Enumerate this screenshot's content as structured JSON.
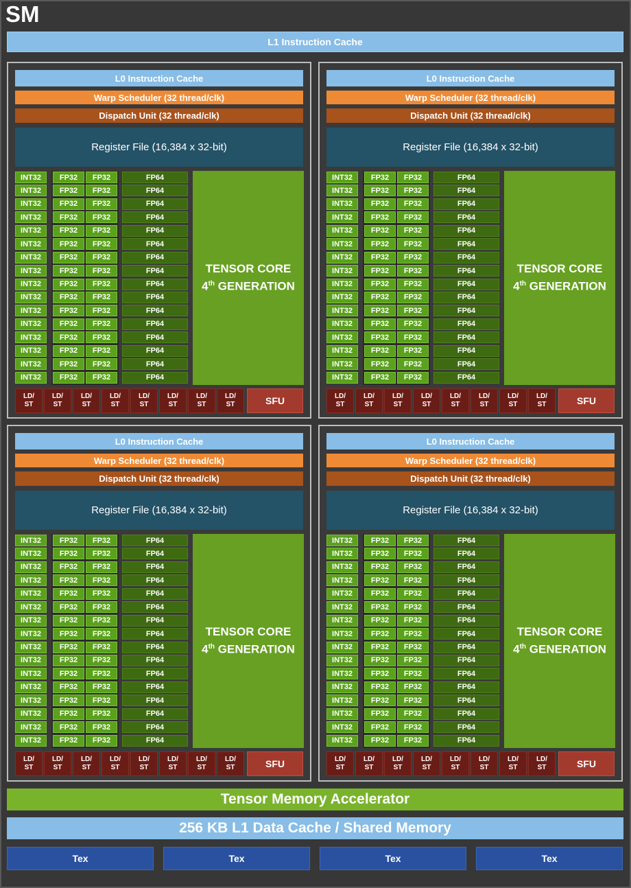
{
  "sm": {
    "title": "SM",
    "l1_instruction_cache": "L1 Instruction Cache",
    "tensor_memory_accelerator": "Tensor Memory Accelerator",
    "l1_data_cache": "256 KB L1 Data Cache / Shared Memory",
    "tex_units": [
      "Tex",
      "Tex",
      "Tex",
      "Tex"
    ]
  },
  "quadrant": {
    "l0_instruction_cache": "L0 Instruction Cache",
    "warp_scheduler": "Warp Scheduler (32 thread/clk)",
    "dispatch_unit": "Dispatch Unit (32 thread/clk)",
    "register_file": "Register File (16,384 x 32-bit)",
    "int32_label": "INT32",
    "fp32_label": "FP32",
    "fp64_label": "FP64",
    "rows_per_column": 16,
    "tensor_core_line1": "TENSOR CORE",
    "tensor_core_line2_num": "4",
    "tensor_core_line2_sup": "th",
    "tensor_core_line2_rest": " GENERATION",
    "ldst_top": "LD/",
    "ldst_bottom": "ST",
    "ldst_count": 8,
    "sfu": "SFU"
  },
  "quadrant_count": 4,
  "colors": {
    "l0_cache": "#87bde6",
    "warp_scheduler": "#ee8a35",
    "dispatch_unit": "#a8521c",
    "register_file": "#245266",
    "int_fp32": "#5aa11c",
    "fp64": "#3e6a12",
    "tensor_core": "#67a022",
    "ldst": "#6a1d16",
    "sfu": "#a33a2e",
    "tma": "#79b32c",
    "tex": "#2a51a0"
  }
}
